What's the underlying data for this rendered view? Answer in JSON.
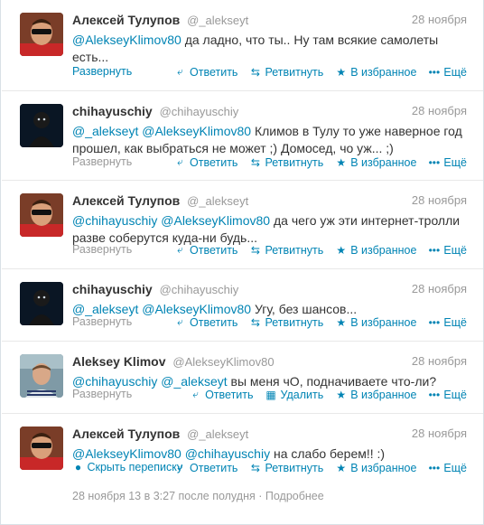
{
  "tweets": [
    {
      "name": "Алексей Тулупов",
      "handle": "@_alekseyt",
      "date": "28 ноября",
      "mentions": [
        "@AlekseyKlimov80"
      ],
      "text": " да ладно, что ты.. Ну там всякие самолеты есть...",
      "expand_label": "Развернуть",
      "actions": [
        "Ответить",
        "Ретвитнуть",
        "В избранное",
        "Ещё"
      ]
    },
    {
      "name": "chihayuschiy",
      "handle": "@chihayuschiy",
      "date": "28 ноября",
      "mentions": [
        "@_alekseyt",
        "@AlekseyKlimov80"
      ],
      "text": " Климов в Тулу то уже наверное год прошел, как выбраться не может ;) Домосед, чо уж... ;)",
      "expand_label": "Развернуть",
      "actions": [
        "Ответить",
        "Ретвитнуть",
        "В избранное",
        "Ещё"
      ]
    },
    {
      "name": "Алексей Тулупов",
      "handle": "@_alekseyt",
      "date": "28 ноября",
      "mentions": [
        "@chihayuschiy",
        "@AlekseyKlimov80"
      ],
      "text": " да чего уж эти интернет-тролли разве соберутся куда-ни будь...",
      "expand_label": "Развернуть",
      "actions": [
        "Ответить",
        "Ретвитнуть",
        "В избранное",
        "Ещё"
      ]
    },
    {
      "name": "chihayuschiy",
      "handle": "@chihayuschiy",
      "date": "28 ноября",
      "mentions": [
        "@_alekseyt",
        "@AlekseyKlimov80"
      ],
      "text": " Угу, без шансов...",
      "expand_label": "Развернуть",
      "actions": [
        "Ответить",
        "Ретвитнуть",
        "В избранное",
        "Ещё"
      ]
    },
    {
      "name": "Aleksey Klimov",
      "handle": "@AlekseyKlimov80",
      "date": "28 ноября",
      "mentions": [
        "@chihayuschiy",
        "@_alekseyt"
      ],
      "text": " вы меня чО, подначиваете что-ли?",
      "expand_label": "Развернуть",
      "actions": [
        "Ответить",
        "Удалить",
        "В избранное",
        "Ещё"
      ]
    },
    {
      "name": "Алексей Тулупов",
      "handle": "@_alekseyt",
      "date": "28 ноября",
      "mentions": [
        "@AlekseyKlimov80",
        "@chihayuschiy"
      ],
      "text": " на слабо берем!! :)",
      "expand_label": "Скрыть переписку",
      "actions": [
        "Ответить",
        "Ретвитнуть",
        "В избранное",
        "Ещё"
      ],
      "timestamp": "28 ноября 13 в 3:27 после полудня",
      "separator": "·",
      "details_label": "Подробнее"
    }
  ],
  "colors": {
    "link": "#0084b4",
    "muted": "#999999",
    "text": "#333333",
    "expanded_bg": "#f5f8fa"
  },
  "icons": {
    "reply": "reply-icon",
    "retweet": "retweet-icon",
    "delete": "trash-icon",
    "favorite": "star-icon",
    "more": "ellipsis-icon",
    "collapse": "speech-bubble-icon"
  }
}
